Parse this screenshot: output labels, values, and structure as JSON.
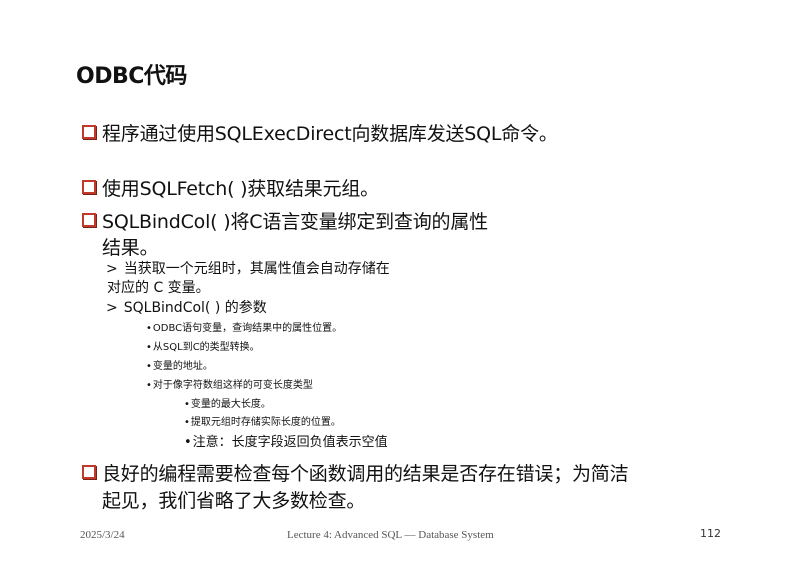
{
  "slide": {
    "title": "ODBC代码",
    "bullets": [
      {
        "text": "程序通过使用SQLExecDirect向数据库发送SQL命令。"
      },
      {
        "text": "使用SQLFetch( )获取结果元组。"
      },
      {
        "text_line1": "SQLBindCol( )将C语言变量绑定到查询的属性",
        "text_line2": "结果。"
      }
    ],
    "sub_items": {
      "item1_marker": ">",
      "item1_line1": "当获取一个元组时，其属性值会自动存储在",
      "item1_line2": "对应的 C 变量。",
      "item2_marker": ">",
      "item2_text": "SQLBindCol( ) 的参数",
      "params": [
        "ODBC语句变量，查询结果中的属性位置。",
        "从SQL到C的类型转换。",
        "变量的地址。",
        "对于像字符数组这样的可变长度类型"
      ],
      "nested": [
        "变量的最大长度。",
        "提取元组时存储实际长度的位置。",
        "注意：长度字段返回负值表示空值"
      ],
      "dot_marker": "•"
    },
    "last_bullet": {
      "line1": "良好的编程需要检查每个函数调用的结果是否存在错误；为简洁",
      "line2": "起见，我们省略了大多数检查。"
    }
  },
  "footer": {
    "date": "2025/3/24",
    "center": "Lecture 4: Advanced SQL — Database System",
    "page": "112"
  },
  "colors": {
    "bullet_border": "#c0392b",
    "text": "#111111",
    "footer_text": "#555555"
  }
}
